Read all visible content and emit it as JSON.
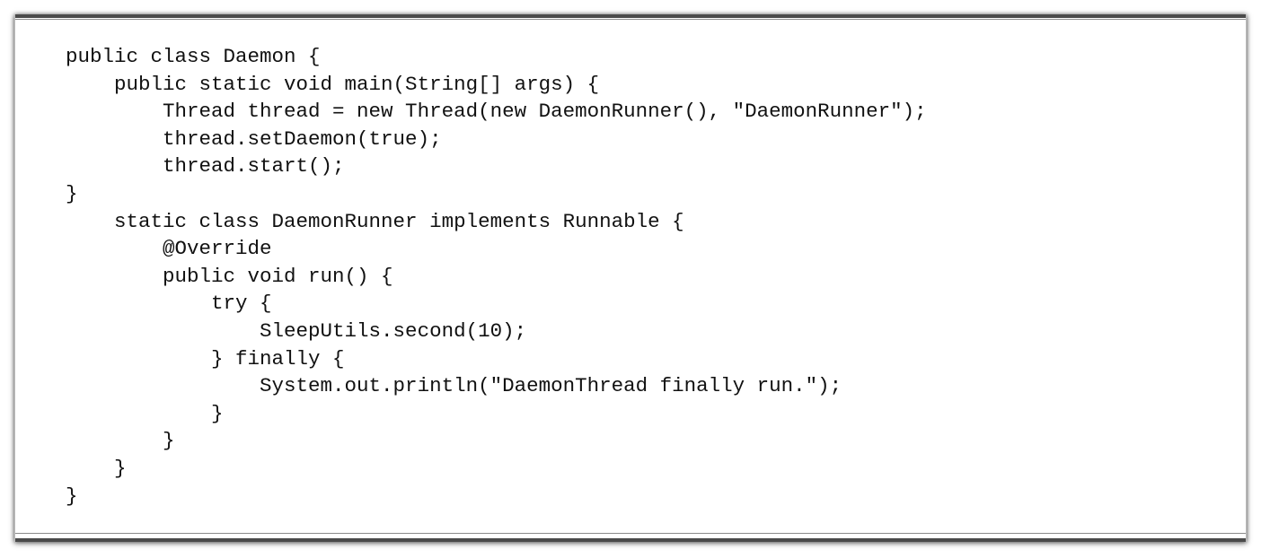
{
  "code_lines": [
    "public class Daemon {",
    "    public static void main(String[] args) {",
    "        Thread thread = new Thread(new DaemonRunner(), \"DaemonRunner\");",
    "        thread.setDaemon(true);",
    "        thread.start();",
    "}",
    "    static class DaemonRunner implements Runnable {",
    "        @Override",
    "        public void run() {",
    "            try {",
    "                SleepUtils.second(10);",
    "            } finally {",
    "                System.out.println(\"DaemonThread finally run.\");",
    "            }",
    "        }",
    "    }",
    "}"
  ]
}
